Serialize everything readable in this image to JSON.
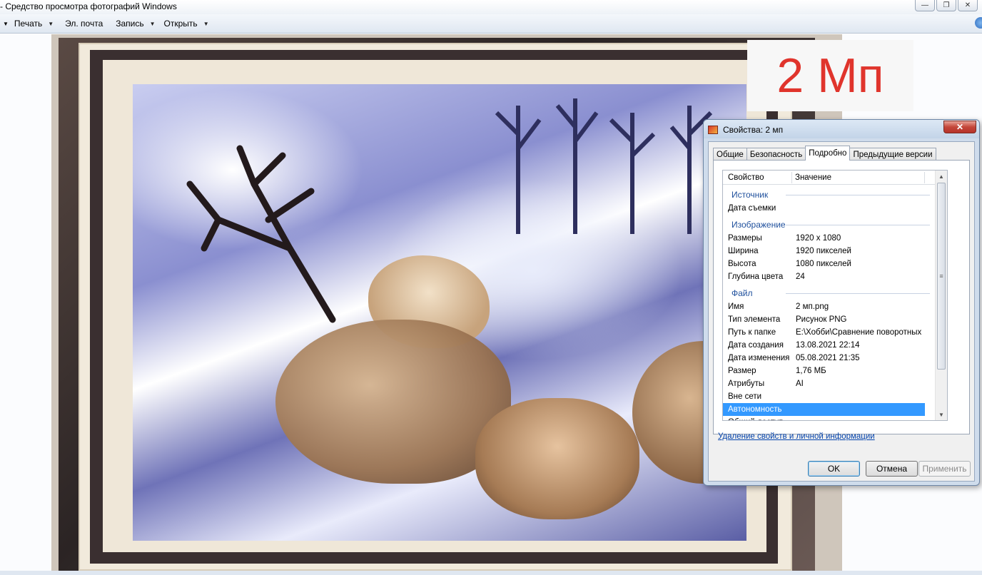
{
  "window": {
    "title": "- Средство просмотра фотографий Windows",
    "buttons": [
      "minimize-icon",
      "restore-icon",
      "close-icon"
    ]
  },
  "toolbar": {
    "items": [
      {
        "label": "Печать",
        "dropdown": true
      },
      {
        "label": "Эл. почта",
        "dropdown": false
      },
      {
        "label": "Запись",
        "dropdown": true
      },
      {
        "label": "Открыть",
        "dropdown": true
      }
    ]
  },
  "overlay": {
    "mp_text": "2 Мп",
    "mp_color": "#e0342c"
  },
  "dialog": {
    "title": "Свойства: 2 мп",
    "tabs": [
      "Общие",
      "Безопасность",
      "Подробно",
      "Предыдущие версии"
    ],
    "active_tab": "Подробно",
    "columns": {
      "property": "Свойство",
      "value": "Значение"
    },
    "rows": [
      {
        "group": "Источник"
      },
      {
        "key": "Дата съемки",
        "value": ""
      },
      {
        "group": "Изображение"
      },
      {
        "key": "Размеры",
        "value": "1920 x 1080"
      },
      {
        "key": "Ширина",
        "value": "1920 пикселей"
      },
      {
        "key": "Высота",
        "value": "1080 пикселей"
      },
      {
        "key": "Глубина цвета",
        "value": "24"
      },
      {
        "group": "Файл"
      },
      {
        "key": "Имя",
        "value": "2 мп.png"
      },
      {
        "key": "Тип элемента",
        "value": "Рисунок PNG"
      },
      {
        "key": "Путь к папке",
        "value": "E:\\Хобби\\Сравнение поворотных"
      },
      {
        "key": "Дата создания",
        "value": "13.08.2021 22:14"
      },
      {
        "key": "Дата изменения",
        "value": "05.08.2021 21:35"
      },
      {
        "key": "Размер",
        "value": "1,76 МБ"
      },
      {
        "key": "Атрибуты",
        "value": "AI"
      },
      {
        "key": "Вне сети",
        "value": ""
      },
      {
        "key": "Автономность",
        "value": "",
        "selected": true
      },
      {
        "key": "Общий доступ",
        "value": ""
      }
    ],
    "remove_link": "Удаление свойств и личной информации",
    "buttons": {
      "ok": "OK",
      "cancel": "Отмена",
      "apply": "Применить"
    },
    "selection_color": "#3399ff"
  }
}
